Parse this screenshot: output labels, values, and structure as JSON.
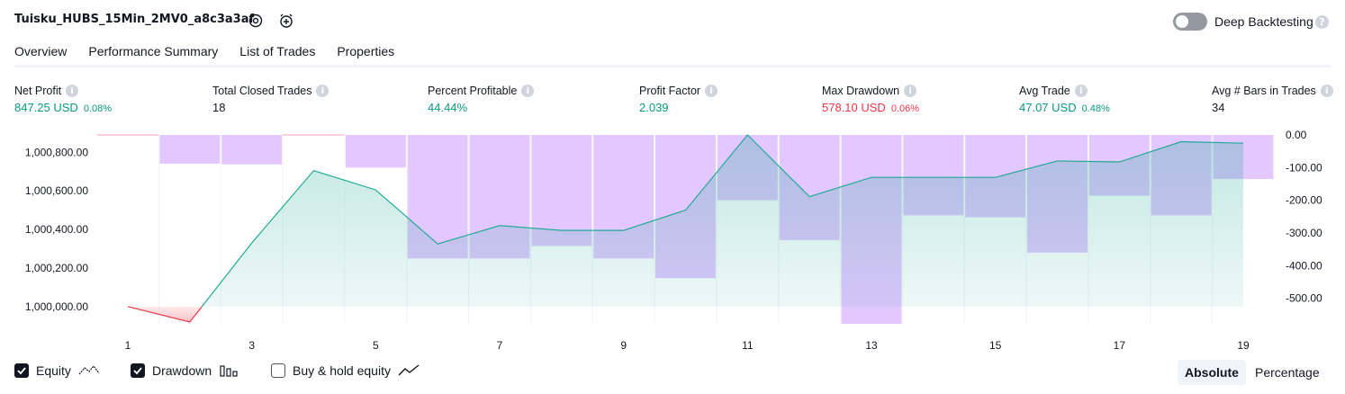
{
  "header": {
    "title": "Tuisku_HUBS_15Min_2MV0_a8c3a3af",
    "deep_backtesting_label": "Deep Backtesting",
    "help_glyph": "?"
  },
  "tabs": [
    {
      "label": "Overview",
      "active": true
    },
    {
      "label": "Performance Summary",
      "active": false
    },
    {
      "label": "List of Trades",
      "active": false
    },
    {
      "label": "Properties",
      "active": false
    }
  ],
  "metrics": {
    "net_profit": {
      "label": "Net Profit",
      "value": "847.25 USD",
      "pct": "0.08%",
      "color": "#089981"
    },
    "total_closed_trades": {
      "label": "Total Closed Trades",
      "value": "18",
      "pct": "",
      "color": "#131722"
    },
    "percent_profitable": {
      "label": "Percent Profitable",
      "value": "44.44%",
      "pct": "",
      "color": "#089981"
    },
    "profit_factor": {
      "label": "Profit Factor",
      "value": "2.039",
      "pct": "",
      "color": "#089981"
    },
    "max_drawdown": {
      "label": "Max Drawdown",
      "value": "578.10 USD",
      "pct": "0.06%",
      "color": "#f23645"
    },
    "avg_trade": {
      "label": "Avg Trade",
      "value": "47.07 USD",
      "pct": "0.48%",
      "color": "#089981"
    },
    "avg_bars": {
      "label": "Avg # Bars in Trades",
      "value": "34",
      "pct": "",
      "color": "#131722"
    }
  },
  "info_glyph": "i",
  "chart_data": {
    "type": "line",
    "title": "",
    "x": [
      1,
      2,
      3,
      4,
      5,
      6,
      7,
      8,
      9,
      10,
      11,
      12,
      13,
      14,
      15,
      16,
      17,
      18,
      19
    ],
    "x_tick_labels": [
      "1",
      "3",
      "5",
      "7",
      "9",
      "11",
      "13",
      "15",
      "17",
      "19"
    ],
    "left_axis": {
      "tick_labels": [
        "1,000,800.00",
        "1,000,600.00",
        "1,000,400.00",
        "1,000,200.00",
        "1,000,000.00"
      ],
      "ylim": [
        999920,
        1000890
      ]
    },
    "right_axis": {
      "tick_labels": [
        "0.00",
        "-100.00",
        "-200.00",
        "-300.00",
        "-400.00",
        "-500.00"
      ],
      "ylim": [
        -578.1,
        0
      ]
    },
    "series": [
      {
        "name": "Equity",
        "axis": "left",
        "color": "#22ab94",
        "values": [
          1000000,
          999920,
          1000330,
          1000705,
          1000605,
          1000325,
          1000420,
          1000395,
          1000395,
          1000500,
          1000890,
          1000570,
          1000670,
          1000670,
          1000670,
          1000755,
          1000750,
          1000855,
          1000847.25
        ]
      },
      {
        "name": "Drawdown",
        "axis": "right",
        "type": "bar",
        "color": "#e1c4ff",
        "values": [
          0,
          -88,
          -90,
          0,
          -100,
          -378,
          -378,
          -340,
          -378,
          -438,
          -200,
          -322,
          -578.1,
          -246,
          -252,
          -360,
          -186,
          -246,
          -135
        ]
      }
    ],
    "grid": true
  },
  "legend": {
    "equity": {
      "label": "Equity",
      "checked": true,
      "icon": "equity-line-icon"
    },
    "drawdown": {
      "label": "Drawdown",
      "checked": true,
      "icon": "drawdown-bars-icon"
    },
    "buy_hold": {
      "label": "Buy & hold equity",
      "checked": false,
      "icon": "buy-hold-line-icon"
    }
  },
  "view_mode": {
    "absolute": "Absolute",
    "percentage": "Percentage",
    "selected": "Absolute"
  },
  "colors": {
    "profit": "#089981",
    "loss": "#f23645",
    "drawdown_bar": "#e1c4ff",
    "equity_line": "#22ab94",
    "text": "#131722"
  }
}
